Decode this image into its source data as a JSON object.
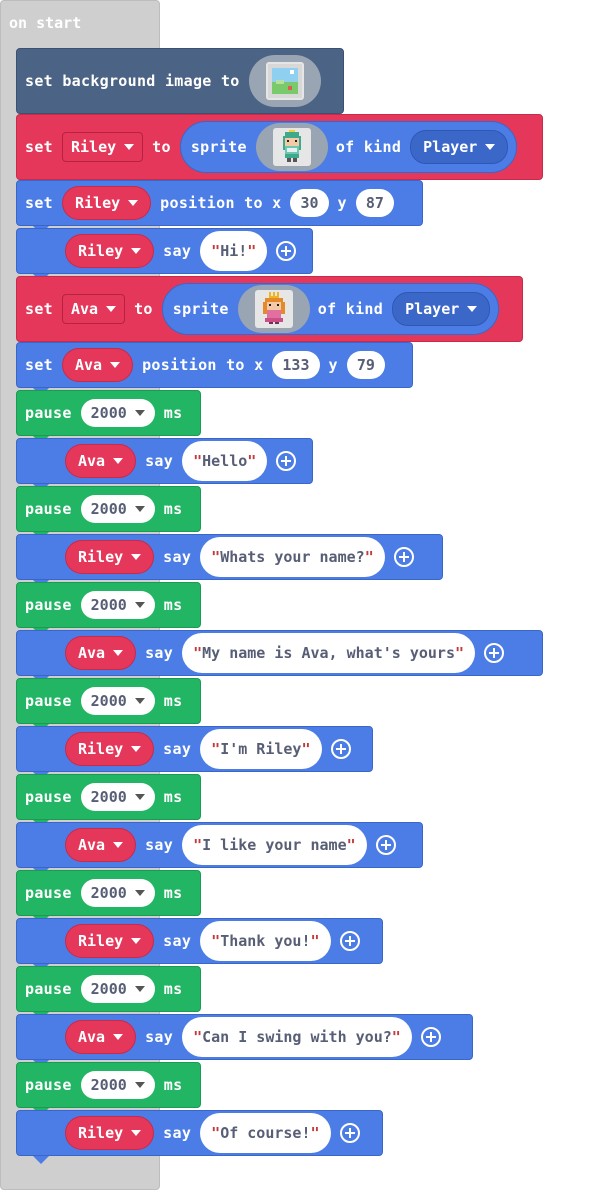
{
  "hat": {
    "label": "on start"
  },
  "colors": {
    "logic_blue": "#4c7de6",
    "variable_red": "#e5375a",
    "loops_green": "#22b664",
    "scene_navy": "#4b6384",
    "hat_gray": "#cfcfcf"
  },
  "blocks": [
    {
      "type": "set_background",
      "label": "set background image to",
      "image": "landscape-thumbnail"
    },
    {
      "type": "set_sprite",
      "set": "set",
      "var": "Riley",
      "to": "to",
      "sprite": "sprite",
      "image": "girl-green-hair-sprite",
      "of_kind": "of kind",
      "kind": "Player"
    },
    {
      "type": "position",
      "set": "set",
      "var": "Riley",
      "text": "position to x",
      "x": "30",
      "y_label": "y",
      "y": "87"
    },
    {
      "type": "say",
      "var": "Riley",
      "say": "say",
      "msg": "Hi!"
    },
    {
      "type": "set_sprite",
      "set": "set",
      "var": "Ava",
      "to": "to",
      "sprite": "sprite",
      "image": "princess-sprite",
      "of_kind": "of kind",
      "kind": "Player"
    },
    {
      "type": "position",
      "set": "set",
      "var": "Ava",
      "text": "position to x",
      "x": "133",
      "y_label": "y",
      "y": "79"
    },
    {
      "type": "pause",
      "label": "pause",
      "ms_value": "2000",
      "unit": "ms"
    },
    {
      "type": "say",
      "var": "Ava",
      "say": "say",
      "msg": "Hello"
    },
    {
      "type": "pause",
      "label": "pause",
      "ms_value": "2000",
      "unit": "ms"
    },
    {
      "type": "say",
      "var": "Riley",
      "say": "say",
      "msg": "Whats your name?"
    },
    {
      "type": "pause",
      "label": "pause",
      "ms_value": "2000",
      "unit": "ms"
    },
    {
      "type": "say",
      "var": "Ava",
      "say": "say",
      "msg": "My name is Ava, what's yours"
    },
    {
      "type": "pause",
      "label": "pause",
      "ms_value": "2000",
      "unit": "ms"
    },
    {
      "type": "say",
      "var": "Riley",
      "say": "say",
      "msg": "I'm Riley"
    },
    {
      "type": "pause",
      "label": "pause",
      "ms_value": "2000",
      "unit": "ms"
    },
    {
      "type": "say",
      "var": "Ava",
      "say": "say",
      "msg": "I like your name"
    },
    {
      "type": "pause",
      "label": "pause",
      "ms_value": "2000",
      "unit": "ms"
    },
    {
      "type": "say",
      "var": "Riley",
      "say": "say",
      "msg": "Thank you!"
    },
    {
      "type": "pause",
      "label": "pause",
      "ms_value": "2000",
      "unit": "ms"
    },
    {
      "type": "say",
      "var": "Ava",
      "say": "say",
      "msg": "Can I swing with you?"
    },
    {
      "type": "pause",
      "label": "pause",
      "ms_value": "2000",
      "unit": "ms"
    },
    {
      "type": "say",
      "var": "Riley",
      "say": "say",
      "msg": "Of course!"
    }
  ]
}
